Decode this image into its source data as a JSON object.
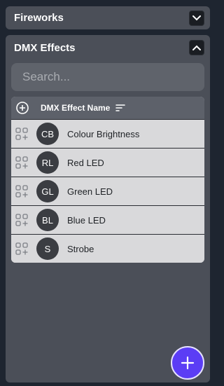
{
  "panels": {
    "fireworks": {
      "title": "Fireworks",
      "expanded": false
    },
    "dmx_effects": {
      "title": "DMX Effects",
      "expanded": true
    }
  },
  "search": {
    "placeholder": "Search..."
  },
  "table": {
    "column_header": "DMX Effect Name",
    "rows": [
      {
        "initials": "CB",
        "name": "Colour Brightness"
      },
      {
        "initials": "RL",
        "name": "Red LED"
      },
      {
        "initials": "GL",
        "name": "Green LED"
      },
      {
        "initials": "BL",
        "name": "Blue LED"
      },
      {
        "initials": "S",
        "name": "Strobe"
      }
    ]
  },
  "icons": {
    "collapse_toggle": "chevron-down-icon",
    "expand_toggle": "chevron-up-icon",
    "add_column": "plus-circle-icon",
    "sort": "sort-icon",
    "row_add": "grid-add-icon",
    "fab": "plus-icon"
  },
  "colors": {
    "accent": "#5b3df5",
    "panel": "#4b4f58",
    "background": "#1e2530"
  }
}
